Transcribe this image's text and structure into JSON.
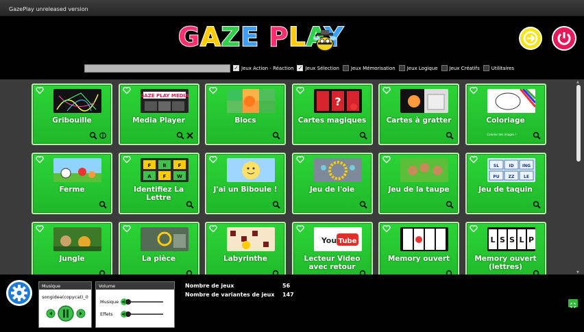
{
  "window": {
    "title": "GazePlay unreleased version"
  },
  "logo": {
    "text": "GAZE PLAY"
  },
  "header": {
    "exit_icon": "exit-arrow-icon",
    "power_icon": "power-icon"
  },
  "search": {
    "value": "",
    "placeholder": ""
  },
  "filters": [
    {
      "label": "Jeux Action - Réaction",
      "checked": true
    },
    {
      "label": "Jeux Sélection",
      "checked": true
    },
    {
      "label": "Jeux Mémorisation",
      "checked": false
    },
    {
      "label": "Jeux Logique",
      "checked": false
    },
    {
      "label": "Jeux Créatifs",
      "checked": false
    },
    {
      "label": "Utilitaires",
      "checked": false
    }
  ],
  "games": [
    {
      "title": "Gribouille",
      "icons": [
        "search-icon",
        "brain-icon"
      ]
    },
    {
      "title": "Media Player",
      "icons": [
        "search-icon",
        "tools-icon"
      ]
    },
    {
      "title": "Blocs",
      "icons": [
        "search-icon"
      ]
    },
    {
      "title": "Cartes magiques",
      "icons": [
        "search-icon"
      ]
    },
    {
      "title": "Cartes à gratter",
      "icons": [
        "search-icon"
      ]
    },
    {
      "title": "Coloriage",
      "subtitle": "Colorier des images !",
      "icons": [
        "search-icon"
      ]
    },
    {
      "title": "Ferme",
      "icons": [
        "search-icon"
      ]
    },
    {
      "title": "Identifiez La Lettre",
      "icons": [
        "search-icon"
      ]
    },
    {
      "title": "J'ai un Biboule !",
      "icons": [
        "search-icon"
      ]
    },
    {
      "title": "Jeu de l'oie",
      "icons": [
        "search-icon"
      ]
    },
    {
      "title": "Jeu de la taupe",
      "icons": [
        "search-icon"
      ]
    },
    {
      "title": "Jeu de taquin",
      "icons": [
        "search-icon"
      ]
    },
    {
      "title": "Jungle",
      "icons": [
        "search-icon"
      ]
    },
    {
      "title": "La pièce",
      "icons": [
        "search-icon"
      ]
    },
    {
      "title": "Labyrinthe",
      "icons": [
        "search-icon"
      ]
    },
    {
      "title": "Lecteur Video avec retour",
      "icons": [
        "search-icon"
      ]
    },
    {
      "title": "Memory ouvert",
      "icons": [
        "search-icon"
      ]
    },
    {
      "title": "Memory ouvert (lettres)",
      "icons": [
        "search-icon"
      ]
    }
  ],
  "thumbs": {
    "media_player": "GAZE PLAY MEDIA",
    "youtube_you": "You",
    "youtube_tube": "Tube",
    "taquin": [
      "SL",
      "ID",
      "ING",
      "PU",
      "ZZ",
      "LE"
    ],
    "memory_letters": [
      "L",
      "S",
      "S",
      "L",
      "P"
    ],
    "letters_grid": [
      "F",
      "B",
      "F",
      "A",
      "F",
      "W"
    ]
  },
  "music": {
    "header": "Musique",
    "track": "songidea(copycat)_0"
  },
  "volume": {
    "header": "Volume",
    "music_label": "Musique",
    "effects_label": "Effets",
    "music_level": 0,
    "effects_level": 0
  },
  "stats": [
    {
      "label": "Nombre de jeux",
      "value": "56"
    },
    {
      "label": "Nombre de variantes de jeux",
      "value": "147"
    }
  ],
  "colors": {
    "card_green": "#22c62f",
    "accent_yellow": "#f5e61c",
    "accent_pink": "#e8195a",
    "settings_blue": "#1b7bd6"
  }
}
